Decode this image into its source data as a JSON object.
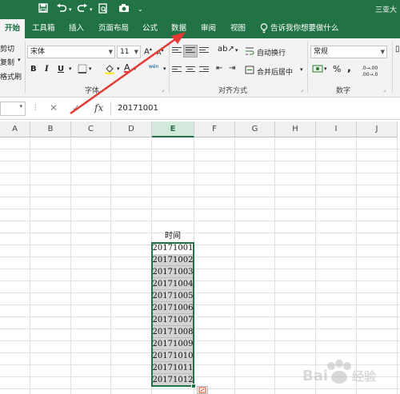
{
  "titlebar": {
    "quick_access": [
      "save-icon",
      "undo-icon",
      "redo-icon",
      "print-preview-icon",
      "camera-icon"
    ],
    "window_title": "三亚大"
  },
  "tabs": [
    {
      "label": "开始",
      "active": true
    },
    {
      "label": "工具箱"
    },
    {
      "label": "插入"
    },
    {
      "label": "页面布局"
    },
    {
      "label": "公式"
    },
    {
      "label": "数据"
    },
    {
      "label": "审阅"
    },
    {
      "label": "视图"
    }
  ],
  "tell_me": "告诉我你想要做什么",
  "clipboard": {
    "cut": "剪切",
    "copy": "复制",
    "format_painter": "格式刷"
  },
  "font": {
    "family": "宋体",
    "size": "11",
    "grow": "A",
    "shrink": "A",
    "bold": "B",
    "italic": "I",
    "underline": "U",
    "color_letter": "A",
    "phonetic": "wén",
    "group_label": "字体"
  },
  "alignment": {
    "wrap_text": "自动换行",
    "merge_center": "合并后居中",
    "group_label": "对齐方式"
  },
  "number": {
    "format": "常规",
    "percent": "%",
    "comma": ",",
    "increase_decimal": ".0→.00",
    "decrease_decimal": ".00→.0",
    "group_label": "数字"
  },
  "formula_bar": {
    "fx_label": "fx",
    "value": "20171001"
  },
  "columns": [
    "A",
    "B",
    "C",
    "D",
    "E",
    "F",
    "G",
    "H",
    "I",
    "J"
  ],
  "selected_column": "E",
  "sheet": {
    "header": "时间",
    "values": [
      "20171001",
      "20171002",
      "20171003",
      "20171004",
      "20171005",
      "20171006",
      "20171007",
      "20171008",
      "20171009",
      "20171010",
      "20171011",
      "20171012"
    ]
  },
  "watermark": "Bai 经验",
  "colors": {
    "ribbon_green": "#217346",
    "annotation_red": "#e53935",
    "selection_gray": "#d3d3d3"
  }
}
